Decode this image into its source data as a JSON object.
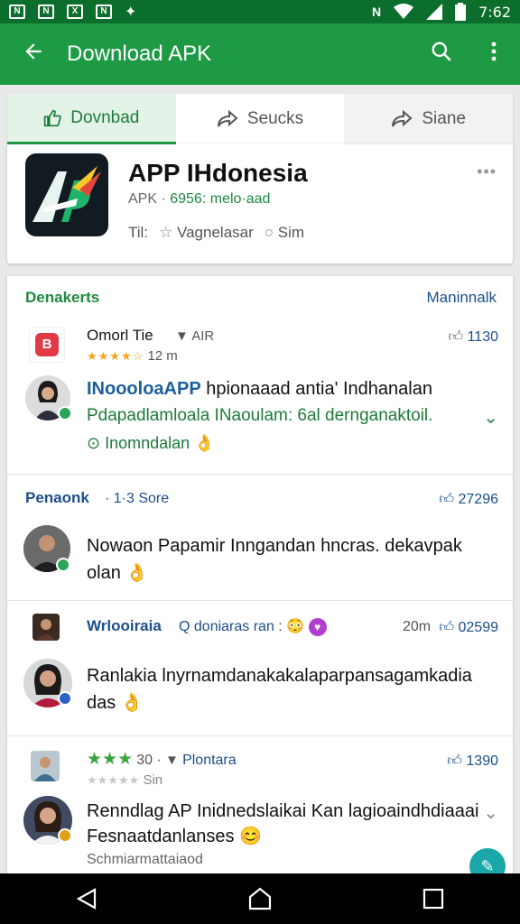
{
  "status": {
    "left_icons": [
      "N",
      "N",
      "X",
      "N",
      "✦"
    ],
    "right_icons": [
      "NFC",
      "wifi",
      "signal",
      "battery"
    ],
    "time": "7:62"
  },
  "appbar": {
    "title": "Download APK",
    "back_icon": "arrow-left",
    "search_icon": "search",
    "menu_icon": "more-vert"
  },
  "tabs": [
    {
      "label": "Dovnbad",
      "icon": "thumb-up-outline"
    },
    {
      "label": "Seucks",
      "icon": "share-arrow"
    },
    {
      "label": "Siane",
      "icon": "share"
    }
  ],
  "app": {
    "name": "APP IHdonesia",
    "meta_type": "APK ·",
    "meta_size": "6956: melo·aad",
    "tags_label": "Til:",
    "tag1": "Vagnelasar",
    "tag2": "Sim",
    "more": "•••"
  },
  "reviews": {
    "header_left": "Denakerts",
    "header_right": "Maninnalk",
    "items": [
      {
        "user": "Omorl Tie",
        "sub": "AIR",
        "stars": "★★★★☆",
        "time": "12 m",
        "likes": "1130",
        "title_prefix": "INoooloaAPP",
        "title_rest": " hpionaaad antia' Indhanalan",
        "line2": "Pdapadlamloala INaoulam: 6al dernganaktoil.",
        "line3": "Inomndalan 👌"
      },
      {
        "user": "Penaonk",
        "sub": "· 1·3  Sore",
        "likes": "27296",
        "text": "Nowaon Papamir  Inngandan hncras. dekavpak",
        "text2": "olan 👌"
      },
      {
        "user": "Wrlooiraia",
        "sub": "doniaras ran :",
        "time": "20m",
        "likes": "02599",
        "text": "Ranlakia lnyrnamdanakakalaparpansagamkadia",
        "text2": "das 👌"
      },
      {
        "stars_big": "★★★",
        "rating_num": "30 ·",
        "sub": "Plontara",
        "stars_small": "★★★★★",
        "sub2": "Sin",
        "likes": "1390",
        "text": "Renndlag AP Inidnedslaikai Kan lagioaindhdiaaai",
        "text2": "Fesnaatdanlanses 😊",
        "text3": "Schmiarmattaiaod"
      }
    ]
  },
  "colors": {
    "status_bar": "#0b6e2c",
    "app_bar": "#1e9a45",
    "accent_green": "#1e8a3f",
    "link_blue": "#1b4f8a",
    "fab": "#19a7a8"
  }
}
